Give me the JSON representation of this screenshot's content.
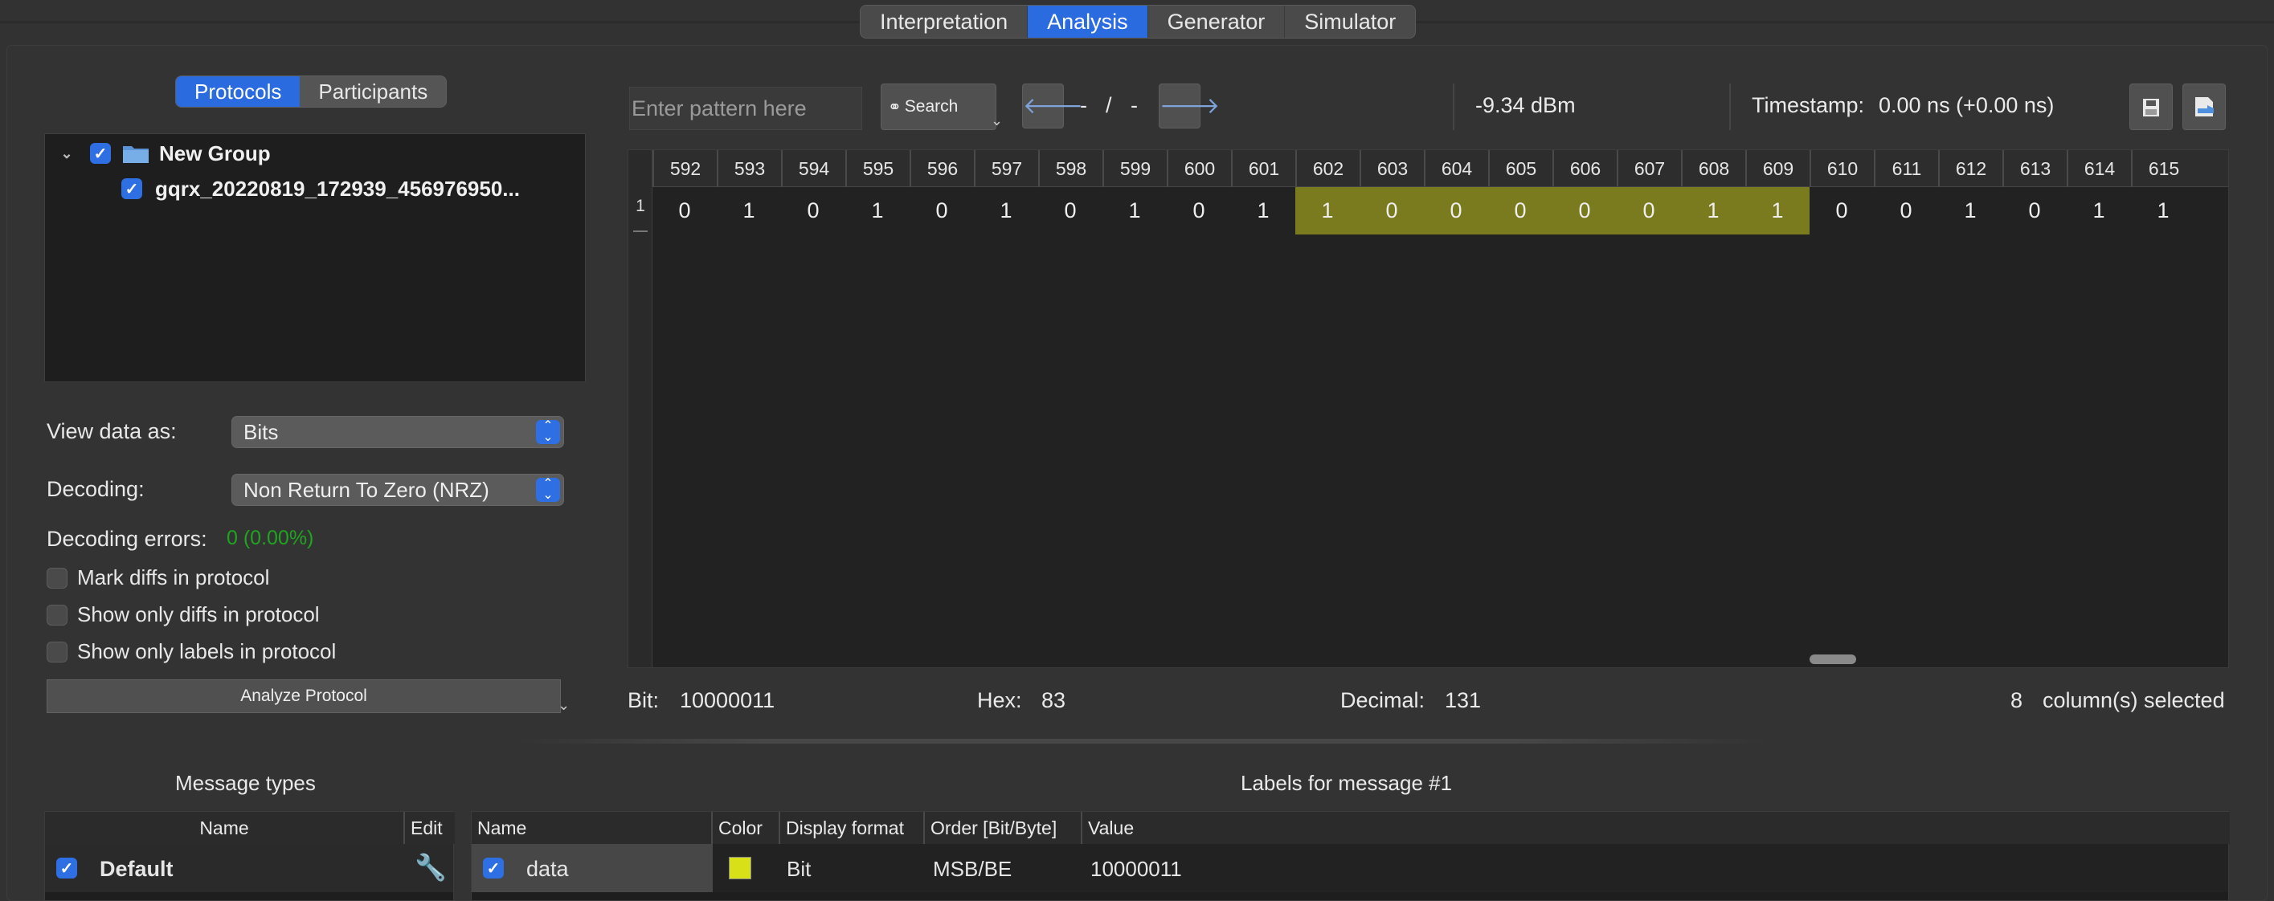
{
  "main_tabs": [
    "Interpretation",
    "Analysis",
    "Generator",
    "Simulator"
  ],
  "active_main_tab": "Analysis",
  "left_tabs": [
    "Protocols",
    "Participants"
  ],
  "active_left_tab": "Protocols",
  "tree": {
    "group_label": "New Group",
    "group_checked": true,
    "file_label": "gqrx_20220819_172939_456976950...",
    "file_checked": true
  },
  "view_data": {
    "label": "View data as:",
    "value": "Bits"
  },
  "decoding": {
    "label": "Decoding:",
    "value": "Non Return To Zero (NRZ)"
  },
  "decoding_errors": {
    "label": "Decoding errors:",
    "value": "0 (0.00%)",
    "value_color": "#1fa51f"
  },
  "options": [
    {
      "label": "Mark diffs in protocol",
      "checked": false
    },
    {
      "label": "Show only diffs in protocol",
      "checked": false
    },
    {
      "label": "Show only labels in protocol",
      "checked": false
    }
  ],
  "analyze_button": "Analyze Protocol",
  "search": {
    "placeholder": "Enter pattern here",
    "button_label": "Search"
  },
  "nav": {
    "current": "-",
    "separator": "/",
    "total": "-"
  },
  "rssi": "-9.34 dBm",
  "timestamp": {
    "label": "Timestamp:",
    "value": "0.00 ns (+0.00 ns)"
  },
  "table": {
    "row_label": "1",
    "columns": [
      "592",
      "593",
      "594",
      "595",
      "596",
      "597",
      "598",
      "599",
      "600",
      "601",
      "602",
      "603",
      "604",
      "605",
      "606",
      "607",
      "608",
      "609",
      "610",
      "611",
      "612",
      "613",
      "614",
      "615"
    ],
    "row_values": [
      "0",
      "1",
      "0",
      "1",
      "0",
      "1",
      "0",
      "1",
      "0",
      "1",
      "1",
      "0",
      "0",
      "0",
      "0",
      "0",
      "1",
      "1",
      "0",
      "0",
      "1",
      "0",
      "1",
      "1"
    ],
    "selected_columns": [
      "602",
      "603",
      "604",
      "605",
      "606",
      "607",
      "608",
      "609"
    ],
    "selection_color": "#7a7a1f"
  },
  "status": {
    "bit_label": "Bit:",
    "bit_value": "10000011",
    "hex_label": "Hex:",
    "hex_value": "83",
    "decimal_label": "Decimal:",
    "decimal_value": "131",
    "selected_count": "8",
    "selected_text": "column(s) selected"
  },
  "message_types": {
    "title": "Message types",
    "headers": {
      "name": "Name",
      "edit": "Edit"
    },
    "rows": [
      {
        "name": "Default",
        "checked": true
      }
    ]
  },
  "labels": {
    "title": "Labels for message #1",
    "headers": {
      "name": "Name",
      "color": "Color",
      "display_format": "Display format",
      "order": "Order [Bit/Byte]",
      "value": "Value"
    },
    "rows": [
      {
        "name": "data",
        "checked": true,
        "color": "#d8e018",
        "display_format": "Bit",
        "order": "MSB/BE",
        "value": "10000011"
      }
    ]
  }
}
